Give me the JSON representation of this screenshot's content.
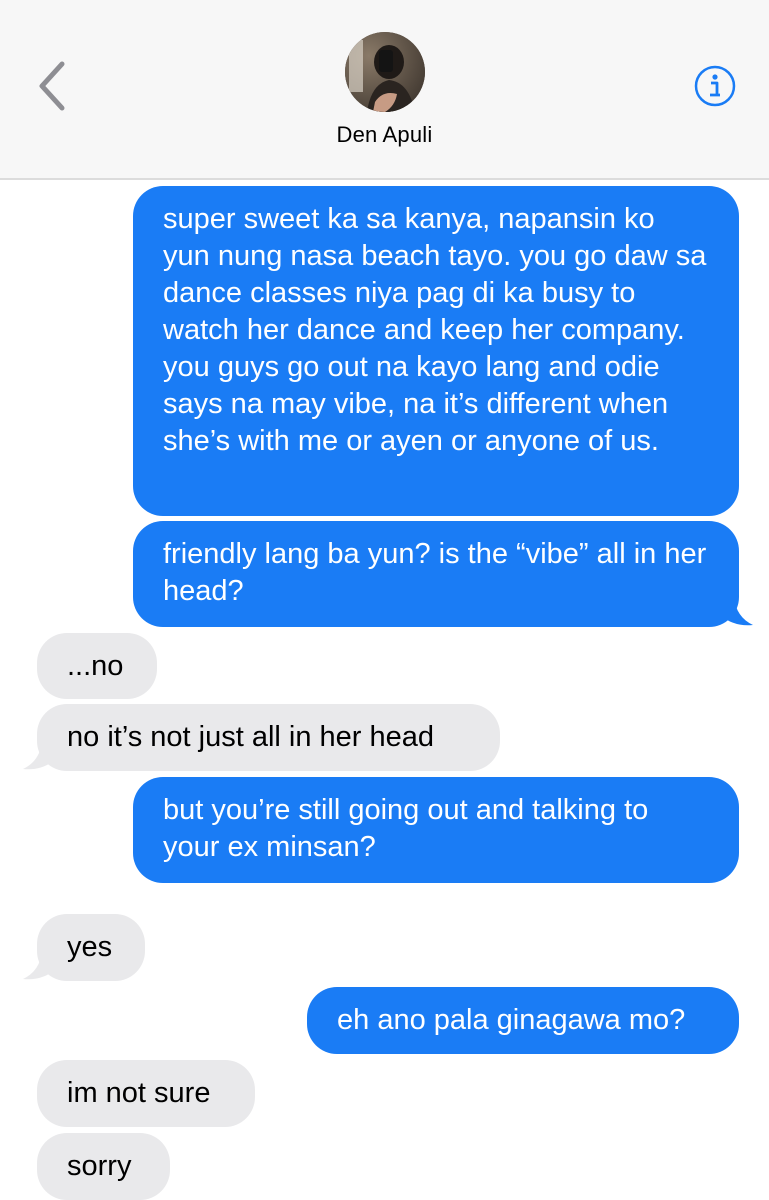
{
  "header": {
    "contact_name": "Den Apuli",
    "back_icon": "chevron-left-icon",
    "info_icon": "info-icon",
    "accent_color": "#1a7cf5"
  },
  "messages": [
    {
      "direction": "outgoing",
      "text": "super sweet ka sa kanya, napansin ko yun nung nasa beach tayo. you go daw sa dance classes niya pag di ka busy to watch her dance and keep her company. you guys go out na kayo lang and odie says na may vibe, na it’s different when she’s with me or ayen or anyone of us."
    },
    {
      "direction": "outgoing",
      "text": "friendly lang ba yun? is the “vibe” all in her head?"
    },
    {
      "direction": "incoming",
      "text": "...no"
    },
    {
      "direction": "incoming",
      "text": "no it’s not just all in her head"
    },
    {
      "direction": "outgoing",
      "text": "but you’re still going out and talking to your ex minsan?"
    },
    {
      "direction": "incoming",
      "text": "yes"
    },
    {
      "direction": "outgoing",
      "text": "eh ano pala ginagawa mo?"
    },
    {
      "direction": "incoming",
      "text": "im not sure"
    },
    {
      "direction": "incoming",
      "text": "sorry"
    }
  ],
  "colors": {
    "outgoing_bubble": "#1a7cf5",
    "incoming_bubble": "#e9e9eb",
    "header_bg": "#f7f7f7"
  }
}
